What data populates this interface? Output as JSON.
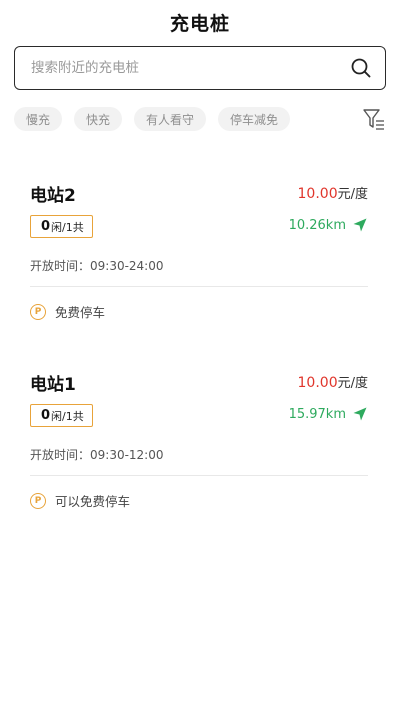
{
  "header": {
    "title": "充电桩"
  },
  "search": {
    "placeholder": "搜索附近的充电桩"
  },
  "filters": [
    "慢充",
    "快充",
    "有人看守",
    "停车减免"
  ],
  "stations": [
    {
      "name": "电站2",
      "price_value": "10.00",
      "price_unit": "元/度",
      "free": "0",
      "free_total": "闲/1共",
      "distance": "10.26km",
      "hours": "开放时间：09:30-24:00",
      "parking": "免费停车"
    },
    {
      "name": "电站1",
      "price_value": "10.00",
      "price_unit": "元/度",
      "free": "0",
      "free_total": "闲/1共",
      "distance": "15.97km",
      "hours": "开放时间：09:30-12:00",
      "parking": "可以免费停车"
    }
  ],
  "colors": {
    "price": "#e0352b",
    "distance": "#2eaa5e",
    "badge_border": "#e8a33a"
  },
  "icons": {
    "search": "search-icon",
    "filter": "filter-icon",
    "navigate": "navigation-arrow-icon",
    "parking": "parking-icon"
  }
}
